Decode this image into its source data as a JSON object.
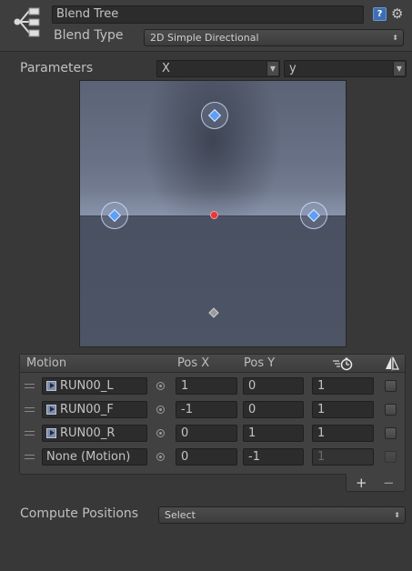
{
  "header": {
    "name_value": "Blend Tree",
    "type_label": "Blend Type",
    "type_value": "2D Simple Directional",
    "help_glyph": "?"
  },
  "parameters": {
    "label": "Parameters",
    "x_value": "X",
    "y_value": "y"
  },
  "motion_list": {
    "headers": {
      "motion": "Motion",
      "pos_x": "Pos X",
      "pos_y": "Pos Y"
    },
    "rows": [
      {
        "motion": "RUN00_L",
        "pos_x": "1",
        "pos_y": "0",
        "time_scale": "1",
        "has_clip": true,
        "enabled": true
      },
      {
        "motion": "RUN00_F",
        "pos_x": "-1",
        "pos_y": "0",
        "time_scale": "1",
        "has_clip": true,
        "enabled": true
      },
      {
        "motion": "RUN00_R",
        "pos_x": "0",
        "pos_y": "1",
        "time_scale": "1",
        "has_clip": true,
        "enabled": true
      },
      {
        "motion": "None (Motion)",
        "pos_x": "0",
        "pos_y": "-1",
        "time_scale": "1",
        "has_clip": false,
        "enabled": false
      }
    ],
    "add_glyph": "+",
    "remove_glyph": "−"
  },
  "compute_positions": {
    "label": "Compute Positions",
    "value": "Select"
  },
  "icons": {
    "header": "blend-tree-icon",
    "help": "help-icon",
    "gear": "gear-icon",
    "time_scale": "stopwatch-icon",
    "mirror": "mirror-icon",
    "dropdown": "dropdown-arrow-icon"
  },
  "colors": {
    "panel_bg": "#383838",
    "point_fill": "#5d9ff7",
    "current_position": "#e13a3a",
    "help_icon": "#3d6fb3"
  }
}
